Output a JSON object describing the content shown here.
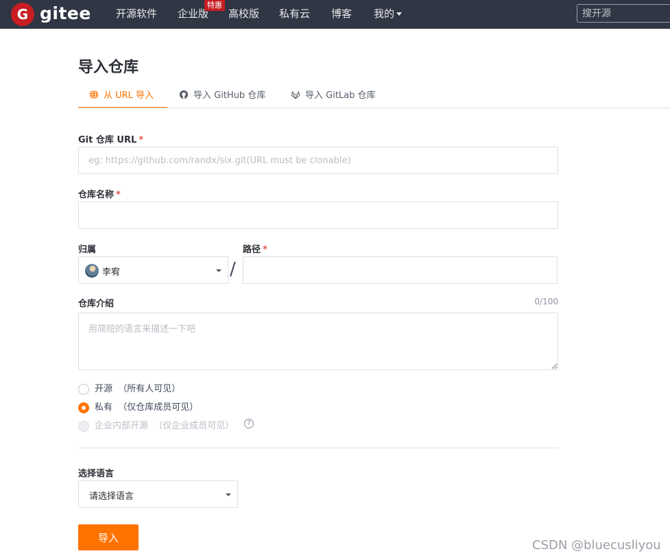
{
  "nav": {
    "logo_letter": "G",
    "brand": "gitee",
    "items": [
      {
        "label": "开源软件"
      },
      {
        "label": "企业版"
      },
      {
        "label": "高校版"
      },
      {
        "label": "私有云"
      },
      {
        "label": "博客"
      },
      {
        "label": "我的"
      }
    ],
    "enterprise_badge": "特惠",
    "search_placeholder": "搜开源"
  },
  "page": {
    "title": "导入仓库",
    "tabs": [
      {
        "label": "从 URL 导入",
        "active": true,
        "icon": "globe-icon"
      },
      {
        "label": "导入 GitHub 仓库",
        "active": false,
        "icon": "github-icon"
      },
      {
        "label": "导入 GitLab 仓库",
        "active": false,
        "icon": "gitlab-icon"
      }
    ]
  },
  "form": {
    "git_url": {
      "label": "Git 仓库 URL",
      "required": "*",
      "placeholder": "eg: https://github.com/randx/six.git(URL must be clonable)",
      "value": ""
    },
    "repo_name": {
      "label": "仓库名称",
      "required": "*",
      "value": ""
    },
    "owner": {
      "label": "归属",
      "value": "李宥"
    },
    "separator": "/",
    "path": {
      "label": "路径",
      "required": "*",
      "value": ""
    },
    "description": {
      "label": "仓库介绍",
      "counter": "0/100",
      "placeholder": "用简短的语言来描述一下吧"
    },
    "visibility": [
      {
        "label": "开源",
        "hint": "（所有人可见）",
        "checked": false,
        "disabled": false
      },
      {
        "label": "私有",
        "hint": "（仅仓库成员可见）",
        "checked": true,
        "disabled": false
      },
      {
        "label": "企业内部开源",
        "hint": "（仅企业成员可见）",
        "checked": false,
        "disabled": true
      }
    ],
    "help_glyph": "?",
    "language": {
      "label": "选择语言",
      "value": "请选择语言"
    },
    "submit_label": "导入"
  },
  "watermark": "CSDN @bluecusliyou",
  "colors": {
    "accent": "#fe7300",
    "nav_bg": "#303643",
    "brand_red": "#c71d23"
  }
}
